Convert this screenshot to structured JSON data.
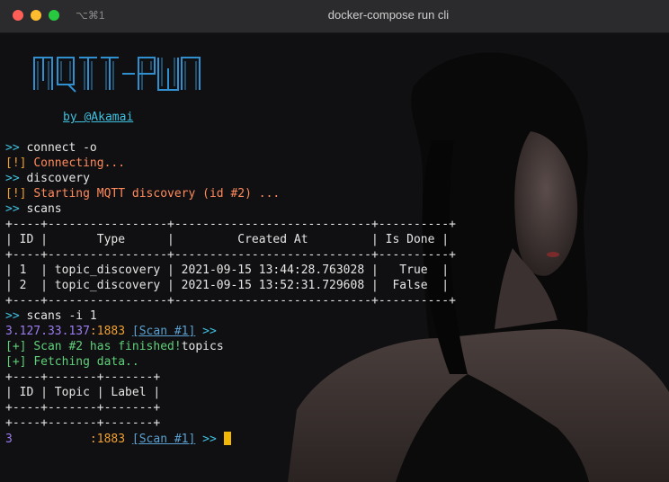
{
  "window": {
    "shortcut": "⌥⌘1",
    "title": "docker-compose run cli"
  },
  "banner": {
    "logo_text": "MQTT-PWN",
    "byline": "by @Akamai"
  },
  "terminal": {
    "prompt": ">>",
    "cmd_connect": "connect -o ",
    "warn_marker": "[!]",
    "connecting": "Connecting...",
    "cmd_discovery": "discovery",
    "discovery_msg": "Starting MQTT discovery (id #2) ...",
    "cmd_scans": "scans",
    "scans_table": {
      "border": "+----+-----------------+----------------------------+----------+",
      "header": "| ID |       Type      |         Created At         | Is Done |",
      "rows": [
        "| 1  | topic_discovery | 2021-09-15 13:44:28.763028 |   True  |",
        "| 2  | topic_discovery | 2021-09-15 13:52:31.729608 |  False  |"
      ]
    },
    "cmd_scans_i": "scans -i 1",
    "ip": "3.127.33.137",
    "port": ":1883",
    "scan_tag": "[Scan #1]",
    "ok_marker": "[+]",
    "scan_finished": "Scan #2 has finished!",
    "typed_topics": "topics",
    "fetching": "Fetching data..",
    "topics_table": {
      "border": "+----+-------+-------+",
      "header": "| ID | Topic | Label |"
    },
    "ip_partial": "3",
    "port_final": ":1883",
    "scan_tag_final": "[Scan #1]"
  },
  "colors": {
    "prompt": "#3fc1e0",
    "warn": "#f0a030",
    "ok": "#5fd07a",
    "ip": "#9b7cf0",
    "cursor": "#f2b705"
  }
}
